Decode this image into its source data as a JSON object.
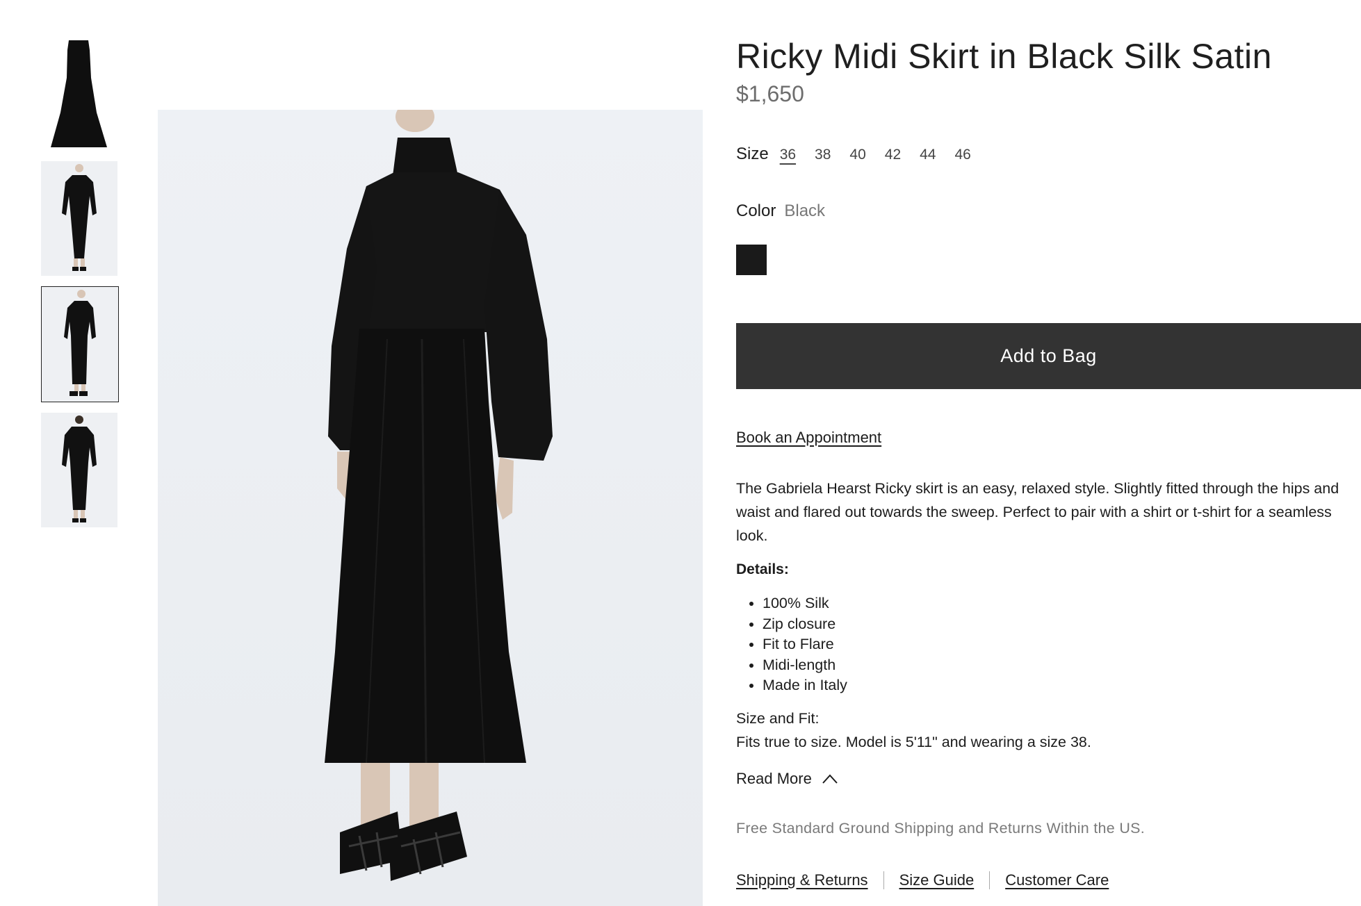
{
  "product": {
    "title": "Ricky Midi Skirt in Black Silk Satin",
    "price": "$1,650"
  },
  "size": {
    "label": "Size",
    "options": [
      "36",
      "38",
      "40",
      "42",
      "44",
      "46"
    ],
    "selected": "36"
  },
  "color": {
    "label": "Color",
    "value": "Black",
    "swatch_hex": "#1a1a1a"
  },
  "actions": {
    "add_to_bag": "Add to Bag",
    "book_appointment": "Book an Appointment",
    "read_more": "Read More"
  },
  "description": "The Gabriela Hearst Ricky skirt is an easy, relaxed style. Slightly fitted through the hips and waist and flared out towards the sweep. Perfect to pair with a shirt or t-shirt for a seamless look.",
  "details": {
    "heading": "Details:",
    "items": [
      "100% Silk",
      "Zip closure",
      "Fit to Flare",
      "Midi-length",
      "Made in Italy"
    ]
  },
  "size_fit": {
    "heading": "Size and Fit:",
    "text": "Fits true to size. Model is 5'11\" and wearing a size 38."
  },
  "shipping_note": "Free Standard Ground Shipping and Returns Within the US.",
  "footer_links": [
    "Shipping & Returns",
    "Size Guide",
    "Customer Care"
  ],
  "gallery": {
    "thumbnail_count": 4,
    "selected_index": 2
  },
  "colors": {
    "button_bg": "#333333",
    "background": "#ffffff",
    "image_bg": "#eef0f3"
  }
}
